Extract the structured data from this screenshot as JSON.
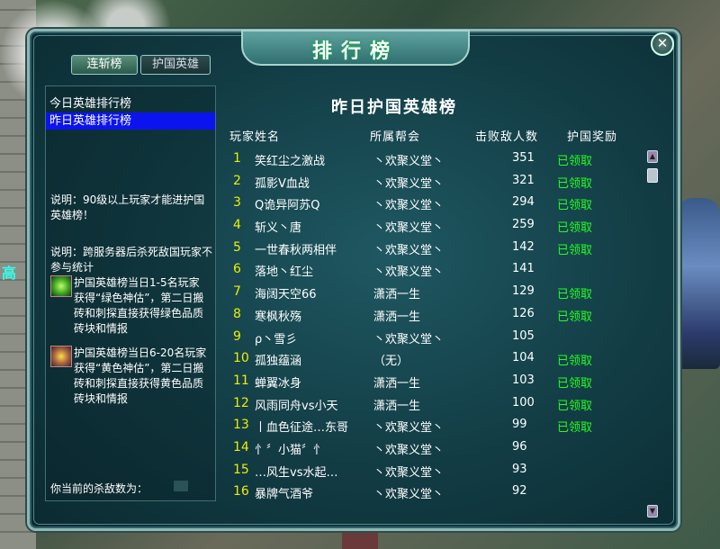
{
  "window": {
    "title": "排行榜",
    "close_label": "✕"
  },
  "tabs": [
    {
      "label": "连斩榜",
      "active": true
    },
    {
      "label": "护国英雄",
      "active": false
    }
  ],
  "sidebar": {
    "items": [
      {
        "label": "今日英雄排行榜",
        "selected": false
      },
      {
        "label": "昨日英雄排行榜",
        "selected": true
      }
    ],
    "note1": "说明：90级以上玩家才能进护国英雄榜！",
    "note2": "说明：跨服务器后杀死敌国玩家不参与统计",
    "reward1": "护国英雄榜当日1-5名玩家获得“绿色神估”，第二日搬砖和刺探直接获得绿色品质砖块和情报",
    "reward2": "护国英雄榜当日6-20名玩家获得“黄色神估”，第二日搬砖和刺探直接获得黄色品质砖块和情报",
    "kill_label": "你当前的杀敌数为：",
    "kill_value": ""
  },
  "board": {
    "title": "昨日护国英雄榜",
    "columns": [
      "玩家姓名",
      "所属帮会",
      "击败敌人数",
      "护国奖励"
    ],
    "rows": [
      {
        "rank": "1",
        "name": "笑红尘之激战",
        "guild": "丶欢聚义堂丶",
        "kills": "351",
        "reward": "已领取"
      },
      {
        "rank": "2",
        "name": "孤影V血战",
        "guild": "丶欢聚义堂丶",
        "kills": "321",
        "reward": "已领取"
      },
      {
        "rank": "3",
        "name": "Q诡异阿苏Q",
        "guild": "丶欢聚义堂丶",
        "kills": "294",
        "reward": "已领取"
      },
      {
        "rank": "4",
        "name": "斩义丶唐",
        "guild": "丶欢聚义堂丶",
        "kills": "259",
        "reward": "已领取"
      },
      {
        "rank": "5",
        "name": "一世春秋两相伴",
        "guild": "丶欢聚义堂丶",
        "kills": "142",
        "reward": "已领取"
      },
      {
        "rank": "6",
        "name": "落地丶红尘",
        "guild": "丶欢聚义堂丶",
        "kills": "141",
        "reward": ""
      },
      {
        "rank": "7",
        "name": "海阔天空66",
        "guild": "潇洒一生",
        "kills": "129",
        "reward": "已领取"
      },
      {
        "rank": "8",
        "name": "寒枫秋殇",
        "guild": "潇洒一生",
        "kills": "126",
        "reward": "已领取"
      },
      {
        "rank": "9",
        "name": "ρ丶雪彡",
        "guild": "丶欢聚义堂丶",
        "kills": "105",
        "reward": ""
      },
      {
        "rank": "10",
        "name": "孤独蕴涵",
        "guild": "（无）",
        "kills": "104",
        "reward": "已领取"
      },
      {
        "rank": "11",
        "name": "蝉翼冰身",
        "guild": "潇洒一生",
        "kills": "103",
        "reward": "已领取"
      },
      {
        "rank": "12",
        "name": "风雨同舟vs小天",
        "guild": "潇洒一生",
        "kills": "100",
        "reward": "已领取"
      },
      {
        "rank": "13",
        "name": "丨血色征途…东哥",
        "guild": "丶欢聚义堂丶",
        "kills": "99",
        "reward": "已领取"
      },
      {
        "rank": "14",
        "name": "忄〞小猫〞忄",
        "guild": "丶欢聚义堂丶",
        "kills": "96",
        "reward": ""
      },
      {
        "rank": "15",
        "name": "…风生vs水起…",
        "guild": "丶欢聚义堂丶",
        "kills": "93",
        "reward": ""
      },
      {
        "rank": "16",
        "name": "暴牌气酒爷",
        "guild": "丶欢聚义堂丶",
        "kills": "92",
        "reward": ""
      }
    ]
  },
  "scene": {
    "left_label": "高"
  }
}
